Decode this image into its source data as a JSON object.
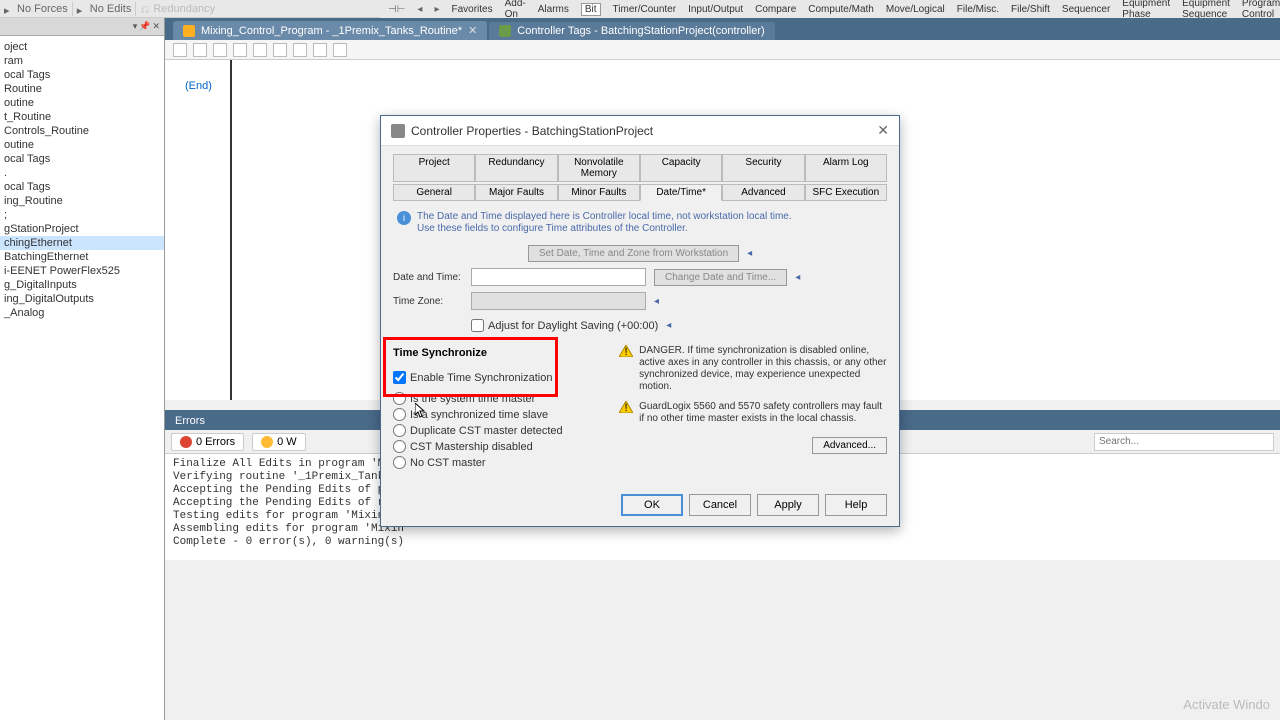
{
  "toolbar": {
    "forces": "No Forces",
    "edits": "No Edits",
    "redundancy": "Redundancy"
  },
  "menu": {
    "items": [
      "Favorites",
      "Add-On",
      "Alarms",
      "Bit",
      "Timer/Counter",
      "Input/Output",
      "Compare",
      "Compute/Math",
      "Move/Logical",
      "File/Misc.",
      "File/Shift",
      "Sequencer",
      "Equipment Phase",
      "Equipment Sequence",
      "Program Control"
    ],
    "active_index": 3
  },
  "tabs": {
    "t0": "Mixing_Control_Program - _1Premix_Tanks_Routine*",
    "t1": "Controller Tags - BatchingStationProject(controller)"
  },
  "tree": {
    "nodes": [
      "oject",
      "ram",
      "ocal Tags",
      "Routine",
      "outine",
      "t_Routine",
      "Controls_Routine",
      "outine",
      "ocal Tags",
      ".",
      "ocal Tags",
      "ing_Routine",
      ";",
      "gStationProject",
      "chingEthernet",
      "BatchingEthernet",
      "i-EENET PowerFlex525",
      "g_DigitalInputs",
      "ing_DigitalOutputs",
      "_Analog"
    ],
    "selected_index": 14
  },
  "editor": {
    "end_label": "(End)"
  },
  "errors": {
    "title": "Errors",
    "err_count": "0 Errors",
    "warn_count": "0 W",
    "search_placeholder": "Search...",
    "lines": "Finalize All Edits in program 'Mixi\nVerifying routine '_1Premix_Tanks_R\nAccepting the Pending Edits of prog\nAccepting the Pending Edits of rout\nTesting edits for program 'Mixing_C\nAssembling edits for program 'Mixin\nComplete - 0 error(s), 0 warning(s)"
  },
  "dialog": {
    "title": "Controller Properties - BatchingStationProject",
    "tabs_row1": [
      "Project",
      "Redundancy",
      "Nonvolatile Memory",
      "Capacity",
      "Security",
      "Alarm Log"
    ],
    "tabs_row2": [
      "General",
      "Major Faults",
      "Minor Faults",
      "Date/Time*",
      "Advanced",
      "SFC Execution"
    ],
    "active_tab": "Date/Time*",
    "info": "The Date and Time displayed here is Controller local time, not workstation local time.\nUse these fields to configure Time attributes of the Controller.",
    "btn_set": "Set Date, Time and Zone from Workstation",
    "lbl_date": "Date and Time:",
    "btn_change": "Change Date and Time...",
    "lbl_zone": "Time Zone:",
    "chk_dst": "Adjust for Daylight Saving (+00:00)",
    "sync_title": "Time Synchronize",
    "chk_enable": "Enable Time Synchronization",
    "radios": [
      "Is the system time master",
      "Is a synchronized time slave",
      "Duplicate CST master detected",
      "CST Mastership disabled",
      "No CST master"
    ],
    "warn1": "DANGER. If time synchronization is disabled online, active axes in any controller in this chassis, or any other synchronized device, may experience unexpected motion.",
    "warn2": "GuardLogix 5560 and 5570 safety controllers may fault if no other time master exists in the local chassis.",
    "btn_advanced": "Advanced...",
    "btn_ok": "OK",
    "btn_cancel": "Cancel",
    "btn_apply": "Apply",
    "btn_help": "Help"
  },
  "watermark": "Activate Windo"
}
